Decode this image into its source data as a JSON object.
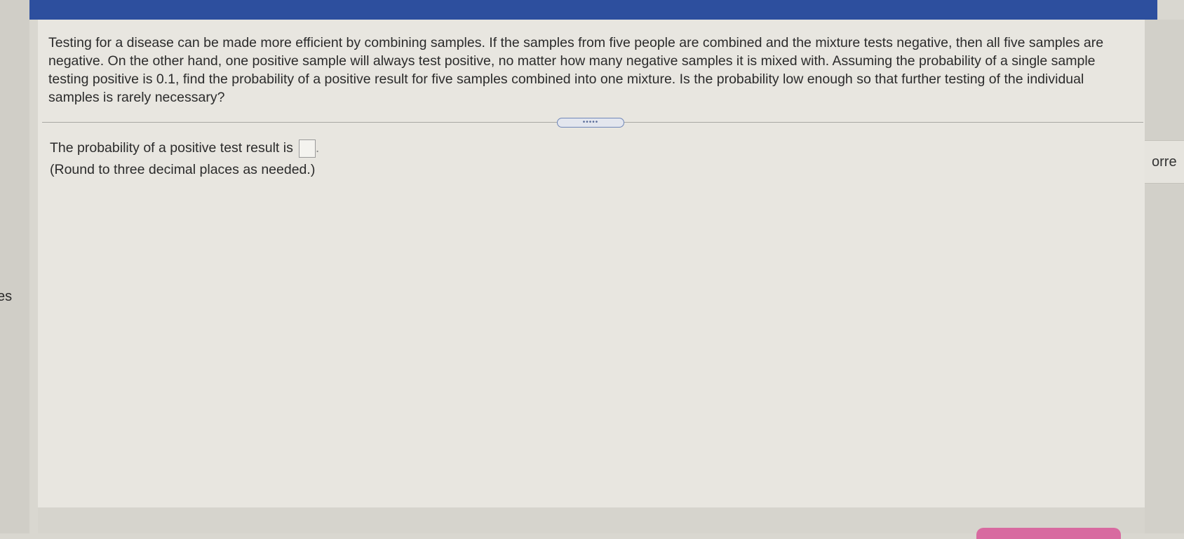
{
  "question": {
    "text": "Testing for a disease can be made more efficient by combining samples. If the samples from five people are combined and the mixture tests negative, then all five samples are negative. On the other hand, one positive sample will always test positive, no matter how many negative samples it is mixed with. Assuming the probability of a single sample testing positive is 0.1, find the probability of a positive result for five samples combined into one mixture. Is the probability low enough so that further testing of the individual samples is rarely necessary?"
  },
  "expand_handle": {
    "label": "•••••"
  },
  "answer": {
    "prompt": "The probability of a positive test result is",
    "value": "",
    "period": ".",
    "hint": "(Round to three decimal places as needed.)"
  },
  "edges": {
    "left_text": "es",
    "right_text": "orre"
  },
  "colors": {
    "header": "#2d4f9e",
    "panel": "#e8e6e0",
    "bottom_button": "#d86aa0"
  }
}
